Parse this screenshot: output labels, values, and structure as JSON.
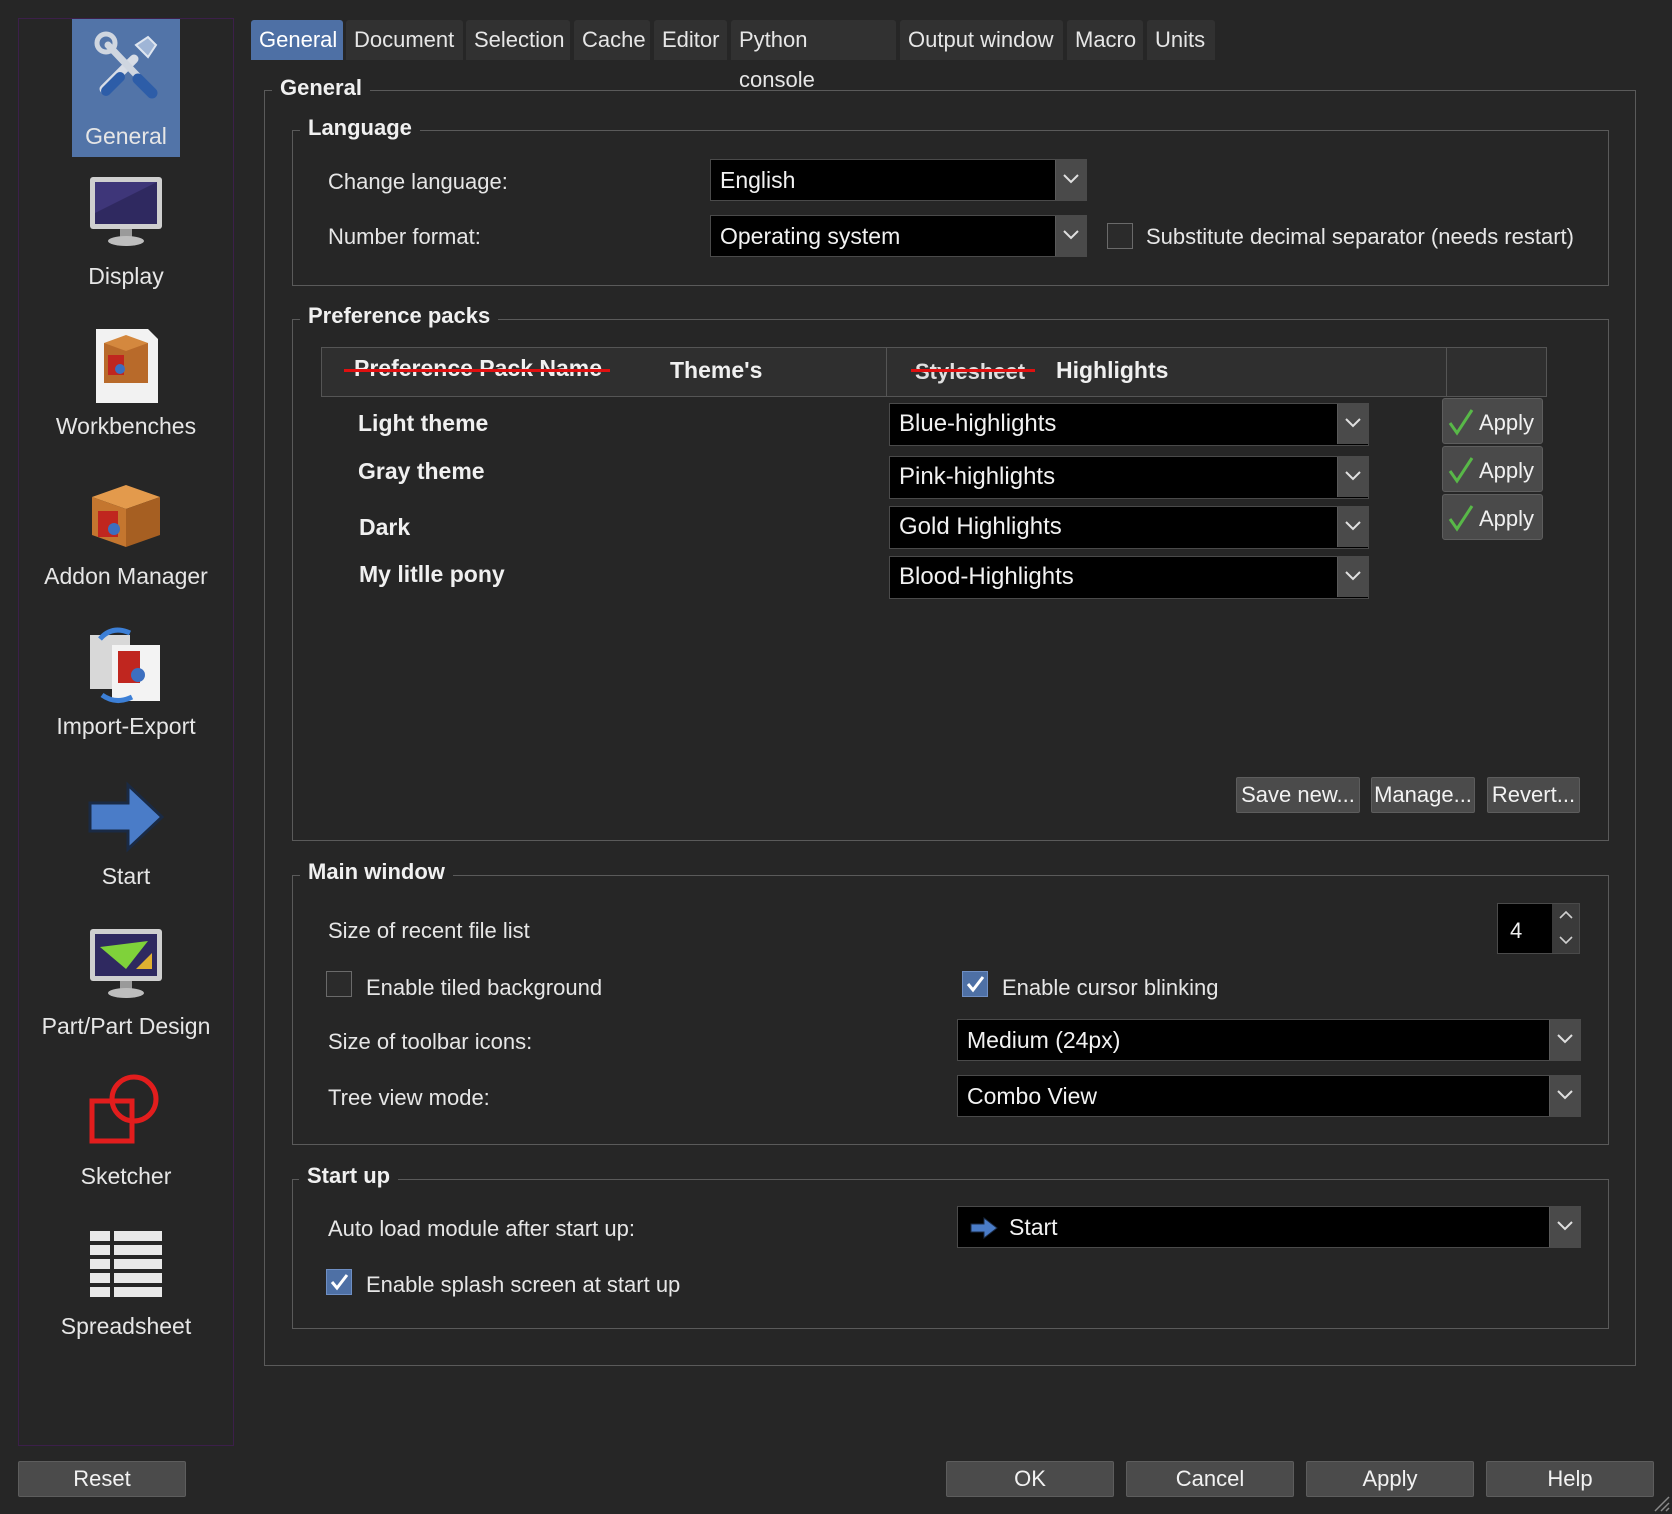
{
  "sidebar": {
    "items": [
      {
        "label": "General",
        "icon": "tools-icon",
        "selected": true
      },
      {
        "label": "Display",
        "icon": "monitor-icon"
      },
      {
        "label": "Workbenches",
        "icon": "workbench-box-icon"
      },
      {
        "label": "Addon Manager",
        "icon": "addon-box-icon"
      },
      {
        "label": "Import-Export",
        "icon": "import-export-icon"
      },
      {
        "label": "Start",
        "icon": "arrow-right-icon"
      },
      {
        "label": "Part/Part Design",
        "icon": "part-design-icon"
      },
      {
        "label": "Sketcher",
        "icon": "sketcher-icon"
      },
      {
        "label": "Spreadsheet",
        "icon": "spreadsheet-icon"
      }
    ]
  },
  "tabs": [
    "General",
    "Document",
    "Selection",
    "Cache",
    "Editor",
    "Python console",
    "Output window",
    "Macro",
    "Units"
  ],
  "general_title": "General",
  "language": {
    "title": "Language",
    "change_language_label": "Change language:",
    "change_language_value": "English",
    "number_format_label": "Number format:",
    "number_format_value": "Operating system",
    "substitute_label": "Substitute decimal separator (needs restart)",
    "substitute_checked": false
  },
  "preference_packs": {
    "title": "Preference packs",
    "header_col1_struck": "Preference Pack Name",
    "header_col1": "Theme's",
    "header_col2_struck": "Stylesheet",
    "header_col2": "Highlights",
    "rows": [
      {
        "name": "Light theme",
        "highlight": "Blue-highlights",
        "apply": "Apply"
      },
      {
        "name": "Gray theme",
        "highlight": "Pink-highlights",
        "apply": "Apply"
      },
      {
        "name": "Dark",
        "highlight": "Gold Highlights",
        "apply": "Apply"
      },
      {
        "name": "My litlle pony",
        "highlight": "Blood-Highlights"
      }
    ],
    "save_new": "Save new...",
    "manage": "Manage...",
    "revert": "Revert..."
  },
  "main_window": {
    "title": "Main window",
    "recent_files_label": "Size of recent file list",
    "recent_files_value": "4",
    "tiled_bg_label": "Enable tiled background",
    "tiled_bg_checked": false,
    "cursor_blink_label": "Enable cursor blinking",
    "cursor_blink_checked": true,
    "toolbar_icons_label": "Size of toolbar icons:",
    "toolbar_icons_value": "Medium (24px)",
    "tree_view_label": "Tree view mode:",
    "tree_view_value": "Combo View"
  },
  "startup": {
    "title": "Start up",
    "auto_load_label": "Auto load module after start up:",
    "auto_load_value": "Start",
    "splash_label": "Enable splash screen at start up",
    "splash_checked": true
  },
  "footer": {
    "reset": "Reset",
    "ok": "OK",
    "cancel": "Cancel",
    "apply": "Apply",
    "help": "Help"
  },
  "colors": {
    "background": "#262626",
    "accent": "#4e70a5",
    "strike": "#e01010"
  }
}
